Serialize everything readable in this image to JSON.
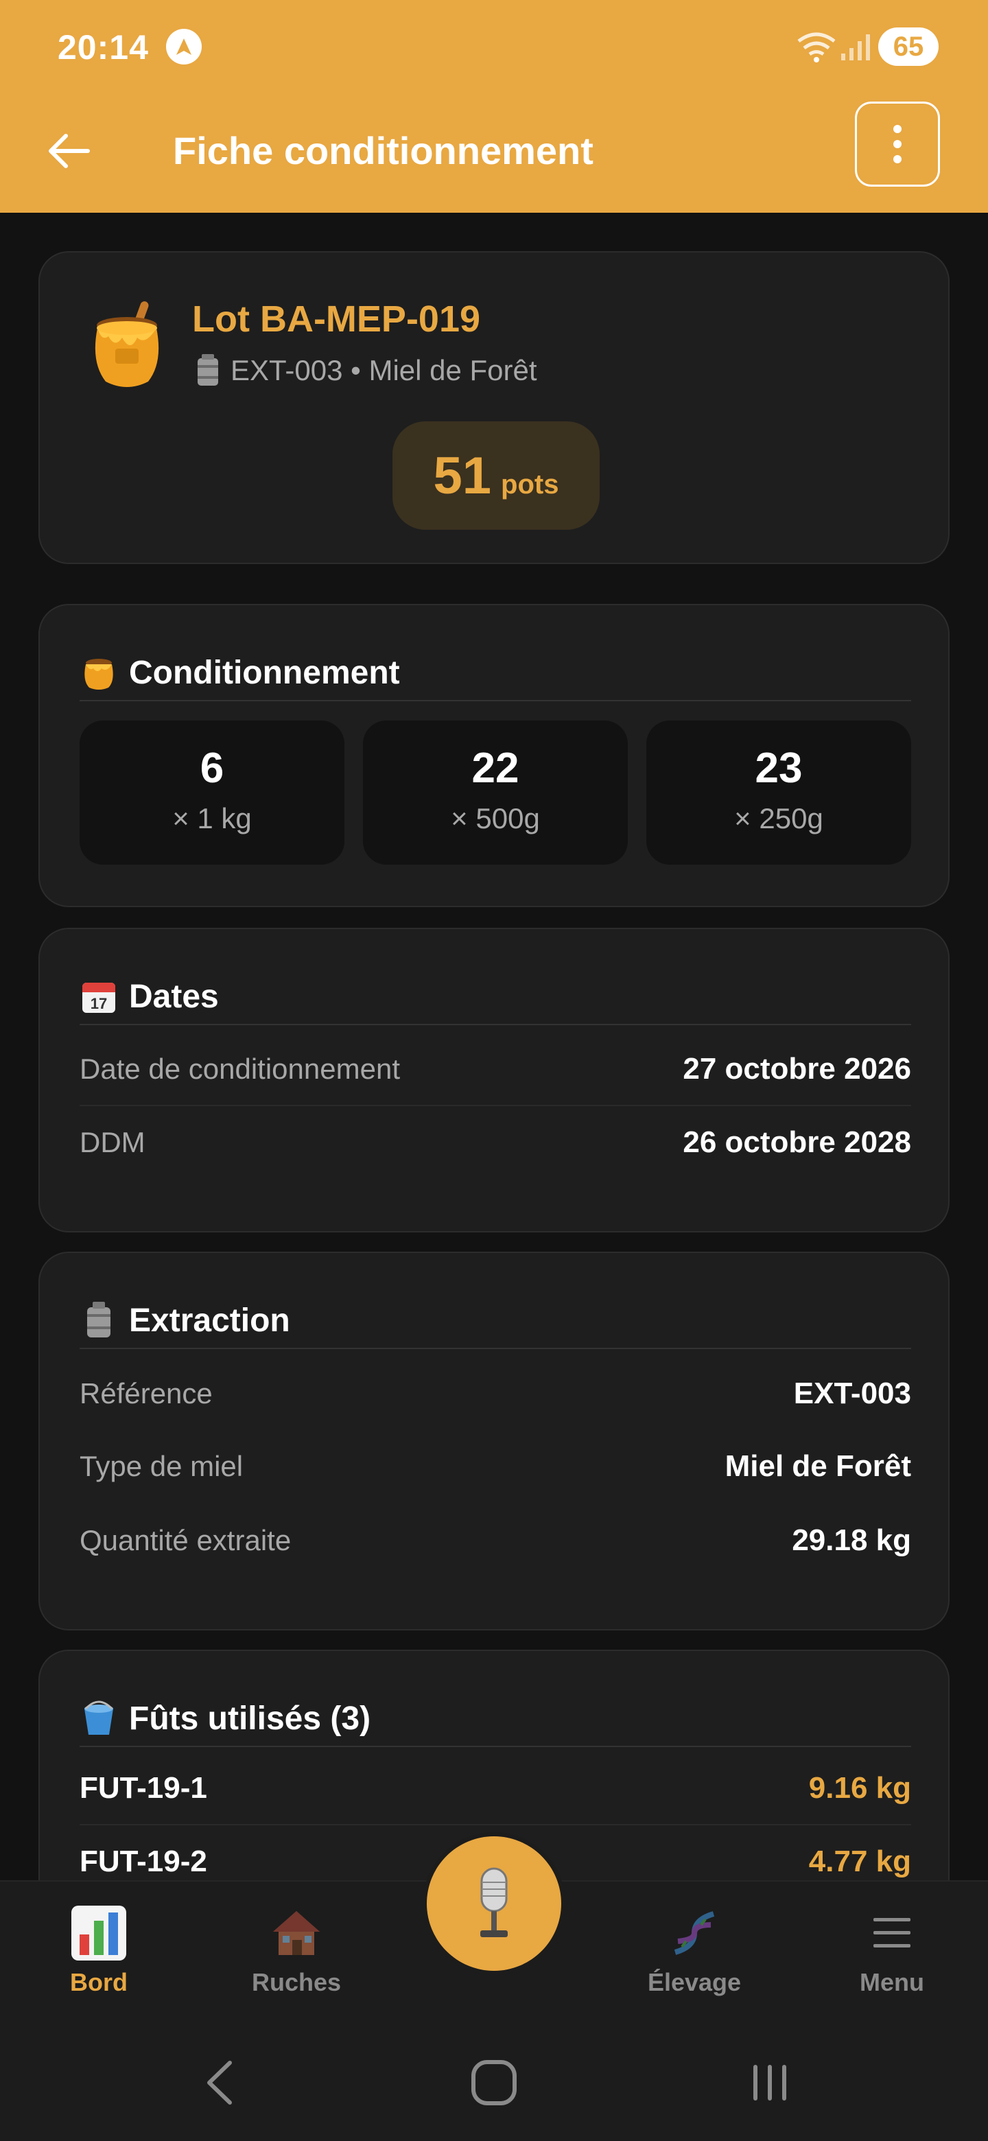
{
  "status_bar": {
    "time": "20:14",
    "battery": "65"
  },
  "header": {
    "title": "Fiche conditionnement"
  },
  "lot": {
    "title": "Lot BA-MEP-019",
    "subtitle": "EXT-003 • Miel de Forêt",
    "pots_count": "51",
    "pots_unit": "pots"
  },
  "conditionnement": {
    "title": "Conditionnement",
    "items": [
      {
        "count": "6",
        "unit": "× 1 kg"
      },
      {
        "count": "22",
        "unit": "× 500g"
      },
      {
        "count": "23",
        "unit": "× 250g"
      }
    ]
  },
  "dates": {
    "title": "Dates",
    "rows": [
      {
        "label": "Date de conditionnement",
        "value": "27 octobre 2026"
      },
      {
        "label": "DDM",
        "value": "26 octobre 2028"
      }
    ]
  },
  "extraction": {
    "title": "Extraction",
    "rows": [
      {
        "label": "Référence",
        "value": "EXT-003"
      },
      {
        "label": "Type de miel",
        "value": "Miel de Forêt"
      },
      {
        "label": "Quantité extraite",
        "value": "29.18 kg"
      }
    ]
  },
  "futs": {
    "title": "Fûts utilisés (3)",
    "rows": [
      {
        "label": "FUT-19-1",
        "value": "9.16 kg"
      },
      {
        "label": "FUT-19-2",
        "value": "4.77 kg"
      }
    ]
  },
  "bottom_nav": {
    "items": [
      {
        "label": "Bord",
        "icon": "bar-chart-icon"
      },
      {
        "label": "Ruches",
        "icon": "house-icon"
      },
      {
        "label": "Élevage",
        "icon": "dna-icon"
      },
      {
        "label": "Menu",
        "icon": "hamburger-icon"
      }
    ],
    "center": {
      "icon": "microphone-icon"
    }
  },
  "colors": {
    "accent": "#E8A842",
    "background": "#121212",
    "card": "#1e1e1e"
  }
}
